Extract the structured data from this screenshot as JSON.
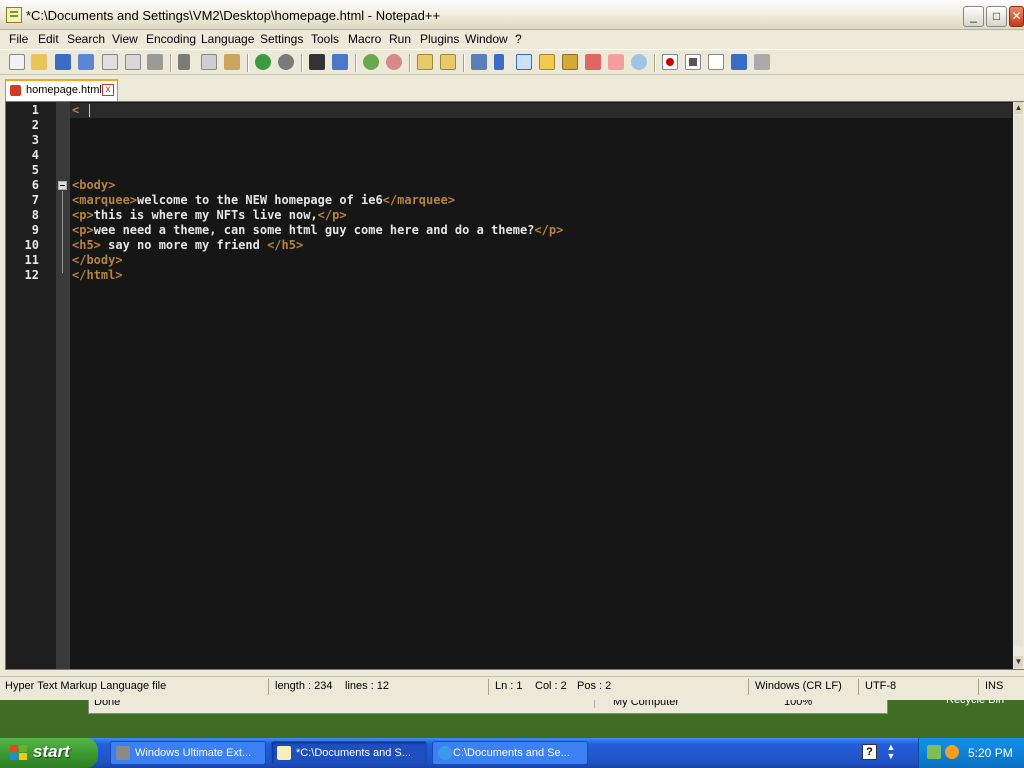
{
  "window": {
    "title": "*C:\\Documents and Settings\\VM2\\Desktop\\homepage.html - Notepad++",
    "minimize": "_",
    "maximize": "□",
    "close": "✕"
  },
  "menu": [
    "File",
    "Edit",
    "Search",
    "View",
    "Encoding",
    "Language",
    "Settings",
    "Tools",
    "Macro",
    "Run",
    "Plugins",
    "Window",
    "?"
  ],
  "tab": {
    "label": "homepage.html",
    "close": "x"
  },
  "editor": {
    "line_numbers": [
      "1",
      "2",
      "3",
      "4",
      "5",
      "6",
      "7",
      "8",
      "9",
      "10",
      "11",
      "12"
    ],
    "lines": [
      {
        "parts": [
          {
            "t": "tag",
            "s": "<"
          }
        ]
      },
      {
        "parts": []
      },
      {
        "parts": []
      },
      {
        "parts": []
      },
      {
        "parts": []
      },
      {
        "parts": [
          {
            "t": "tag",
            "s": "<body>"
          }
        ]
      },
      {
        "parts": [
          {
            "t": "tag",
            "s": "<marquee>"
          },
          {
            "t": "txt",
            "s": "welcome to the NEW homepage of ie6"
          },
          {
            "t": "tag",
            "s": "</marquee>"
          }
        ]
      },
      {
        "parts": [
          {
            "t": "tag",
            "s": "<p>"
          },
          {
            "t": "txt",
            "s": "this is where my NFTs live now,"
          },
          {
            "t": "tag",
            "s": "</p>"
          }
        ]
      },
      {
        "parts": [
          {
            "t": "tag",
            "s": "<p>"
          },
          {
            "t": "txt",
            "s": "wee need a theme, can some html guy come here and do a theme?"
          },
          {
            "t": "tag",
            "s": "</p>"
          }
        ]
      },
      {
        "parts": [
          {
            "t": "tag",
            "s": "<h5>"
          },
          {
            "t": "txt",
            "s": " say no more my friend "
          },
          {
            "t": "tag",
            "s": "</h5>"
          }
        ]
      },
      {
        "parts": [
          {
            "t": "tag",
            "s": "</body>"
          }
        ]
      },
      {
        "parts": [
          {
            "t": "tag",
            "s": "</html>"
          }
        ]
      }
    ]
  },
  "statusbar": {
    "file_type": "Hyper Text Markup Language file",
    "length": "length : 234",
    "lines": "lines : 12",
    "ln": "Ln : 1",
    "col": "Col : 2",
    "pos": "Pos : 2",
    "eol": "Windows (CR LF)",
    "encoding": "UTF-8",
    "mode": "INS"
  },
  "background_window": {
    "status": "Done",
    "zone": "My Computer",
    "zoom": "100%",
    "desktop_icon": "Recycle Bin"
  },
  "taskbar": {
    "start": "start",
    "items": [
      {
        "label": "Windows Ultimate Ext...",
        "icon": "gear-icon"
      },
      {
        "label": "*C:\\Documents and S...",
        "icon": "notepadpp-icon"
      },
      {
        "label": "C:\\Documents and Se...",
        "icon": "ie-icon"
      }
    ],
    "help": "?",
    "clock": "5:20 PM"
  },
  "colors": {
    "tag": "#b58440",
    "text": "#e6e6e6",
    "editor_bg": "#161616"
  }
}
